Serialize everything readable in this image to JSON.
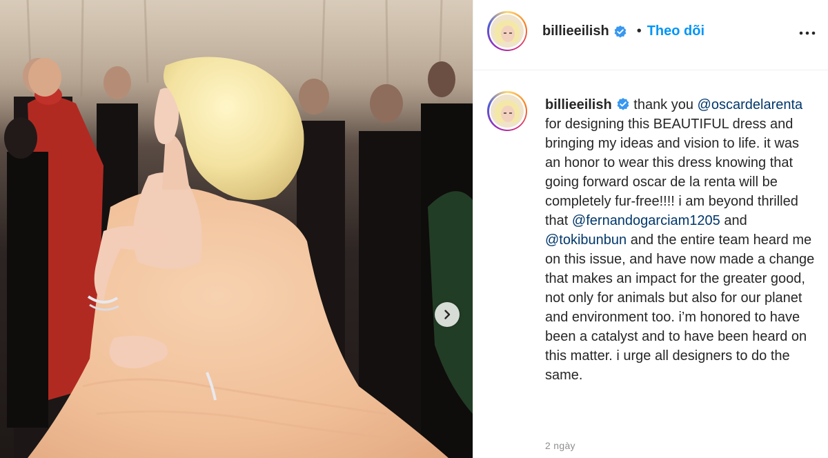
{
  "post": {
    "username": "billieeilish",
    "follow_label": "Theo dõi",
    "separator": "•",
    "caption_segments": [
      {
        "type": "text",
        "value": " thank you "
      },
      {
        "type": "mention",
        "value": "@oscardelarenta"
      },
      {
        "type": "text",
        "value": " for designing this BEAUTIFUL dress and bringing my ideas and vision to life. it was an honor to wear this dress knowing that going forward oscar de la renta will be completely fur-free!!!! i am beyond thrilled that "
      },
      {
        "type": "mention",
        "value": "@fernandogarciam1205"
      },
      {
        "type": "text",
        "value": " and "
      },
      {
        "type": "mention",
        "value": "@tokibunbun"
      },
      {
        "type": "text",
        "value": " and the entire team heard me on this issue, and have now made a change that makes an impact for the greater good, not only for animals but also for our planet and environment too. i’m honored to have been a catalyst and to have been heard on this matter. i urge all designers to do the same."
      }
    ],
    "timestamp": "2 ngày"
  },
  "icons": {
    "verified": "verified-badge-icon",
    "more": "more-options-icon",
    "next": "chevron-right-icon"
  },
  "colors": {
    "follow": "#0095f6",
    "mention": "#00376b",
    "verified": "#3897f0"
  }
}
